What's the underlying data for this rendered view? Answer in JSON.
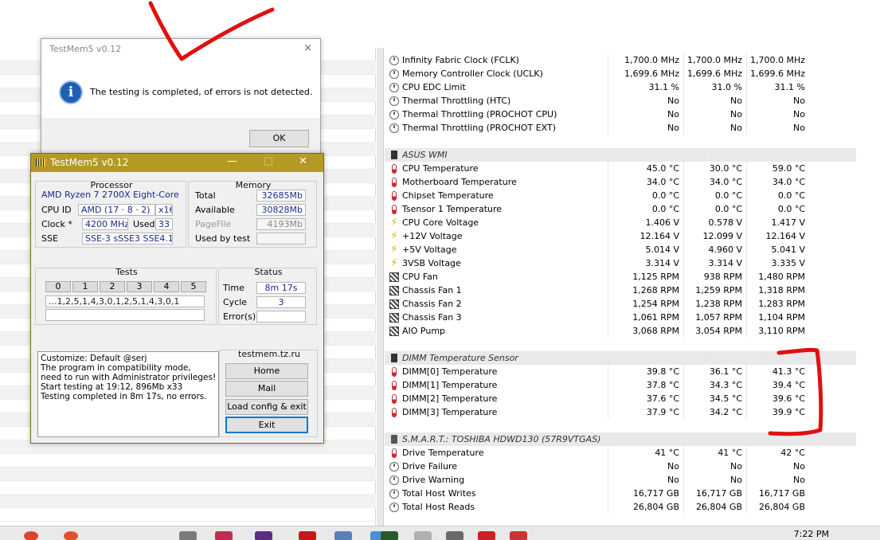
{
  "msgbox": {
    "title": "TestMem5 v0.12",
    "close": "×",
    "info_glyph": "i",
    "text": "The testing is completed, of errors is not detected.",
    "ok": "OK"
  },
  "tm": {
    "title": "TestMem5 v0.12",
    "minimize": "—",
    "maximize": "□",
    "close": "✕",
    "processor": {
      "heading": "Processor",
      "name": "AMD Ryzen 7 2700X Eight-Core",
      "cpuid_label": "CPU ID",
      "cpuid": "AMD  (17 · 8 · 2)",
      "arch": "x16",
      "clock_label": "Clock *",
      "clock": "4200 MHz",
      "used_label": "Used",
      "used": "33",
      "sse_label": "SSE",
      "sse": "SSE-3 sSSE3 SSE4.1"
    },
    "memory": {
      "heading": "Memory",
      "total_label": "Total",
      "total": "32685Mb",
      "available_label": "Available",
      "available": "30828Mb",
      "pagefile_label": "PageFile",
      "pagefile": "4193Mb",
      "usedbytest_label": "Used by test",
      "usedbytest": ""
    },
    "tests": {
      "heading": "Tests",
      "cells": [
        "0",
        "1",
        "2",
        "3",
        "4",
        "5"
      ],
      "sequence": "...1,2,5,1,4,3,0,1,2,5,1,4,3,0,1"
    },
    "status": {
      "heading": "Status",
      "time_label": "Time",
      "time": "8m 17s",
      "cycle_label": "Cycle",
      "cycle": "3",
      "errors_label": "Error(s)",
      "errors": ""
    },
    "log": "Customize: Default @serj\nThe program in compatibility mode,\nneed to run with Administrator privileges!\nStart testing at 19:12, 896Mb x33\nTesting completed in 8m 17s, no errors.",
    "site": "testmem.tz.ru",
    "buttons": {
      "home": "Home",
      "mail": "Mail",
      "load": "Load config & exit",
      "exit": "Exit"
    }
  },
  "sensors": [
    {
      "type": "row",
      "icon": "clock-icon",
      "name": "Infinity Fabric Clock (FCLK)",
      "cur": "1,700.0 MHz",
      "min": "1,700.0 MHz",
      "max": "1,700.0 MHz"
    },
    {
      "type": "row",
      "icon": "clock-icon",
      "name": "Memory Controller Clock (UCLK)",
      "cur": "1,699.6 MHz",
      "min": "1,699.6 MHz",
      "max": "1,699.6 MHz"
    },
    {
      "type": "row",
      "icon": "clock-icon",
      "name": "CPU EDC Limit",
      "cur": "31.1 %",
      "min": "31.0 %",
      "max": "31.1 %"
    },
    {
      "type": "row",
      "icon": "clock-icon",
      "name": "Thermal Throttling (HTC)",
      "cur": "No",
      "min": "No",
      "max": "No"
    },
    {
      "type": "row",
      "icon": "clock-icon",
      "name": "Thermal Throttling (PROCHOT CPU)",
      "cur": "No",
      "min": "No",
      "max": "No"
    },
    {
      "type": "row",
      "icon": "clock-icon",
      "name": "Thermal Throttling (PROCHOT EXT)",
      "cur": "No",
      "min": "No",
      "max": "No"
    },
    {
      "type": "blank"
    },
    {
      "type": "group",
      "icon": "chip-icon",
      "name": "ASUS WMI"
    },
    {
      "type": "row",
      "icon": "thermometer-icon",
      "name": "CPU Temperature",
      "cur": "45.0 °C",
      "min": "30.0 °C",
      "max": "59.0 °C"
    },
    {
      "type": "row",
      "icon": "thermometer-icon",
      "name": "Motherboard Temperature",
      "cur": "34.0 °C",
      "min": "34.0 °C",
      "max": "34.0 °C"
    },
    {
      "type": "row",
      "icon": "thermometer-icon",
      "name": "Chipset Temperature",
      "cur": "0.0 °C",
      "min": "0.0 °C",
      "max": "0.0 °C"
    },
    {
      "type": "row",
      "icon": "thermometer-icon",
      "name": "Tsensor 1 Temperature",
      "cur": "0.0 °C",
      "min": "0.0 °C",
      "max": "0.0 °C"
    },
    {
      "type": "row",
      "icon": "voltage-icon",
      "name": "CPU Core Voltage",
      "cur": "1.406 V",
      "min": "0.578 V",
      "max": "1.417 V"
    },
    {
      "type": "row",
      "icon": "voltage-icon",
      "name": "+12V Voltage",
      "cur": "12.164 V",
      "min": "12.099 V",
      "max": "12.164 V"
    },
    {
      "type": "row",
      "icon": "voltage-icon",
      "name": "+5V Voltage",
      "cur": "5.014 V",
      "min": "4.960 V",
      "max": "5.041 V"
    },
    {
      "type": "row",
      "icon": "voltage-icon",
      "name": "3VSB Voltage",
      "cur": "3.314 V",
      "min": "3.314 V",
      "max": "3.335 V"
    },
    {
      "type": "row",
      "icon": "fan-icon",
      "name": "CPU Fan",
      "cur": "1,125 RPM",
      "min": "938 RPM",
      "max": "1,480 RPM"
    },
    {
      "type": "row",
      "icon": "fan-icon",
      "name": "Chassis Fan 1",
      "cur": "1,268 RPM",
      "min": "1,259 RPM",
      "max": "1,318 RPM"
    },
    {
      "type": "row",
      "icon": "fan-icon",
      "name": "Chassis Fan 2",
      "cur": "1,254 RPM",
      "min": "1,238 RPM",
      "max": "1,283 RPM"
    },
    {
      "type": "row",
      "icon": "fan-icon",
      "name": "Chassis Fan 3",
      "cur": "1,061 RPM",
      "min": "1,057 RPM",
      "max": "1,104 RPM"
    },
    {
      "type": "row",
      "icon": "fan-icon",
      "name": "AIO Pump",
      "cur": "3,068 RPM",
      "min": "3,054 RPM",
      "max": "3,110 RPM"
    },
    {
      "type": "blank"
    },
    {
      "type": "group",
      "icon": "chip-icon",
      "name": "DIMM Temperature Sensor"
    },
    {
      "type": "row",
      "icon": "thermometer-icon",
      "name": "DIMM[0] Temperature",
      "cur": "39.8 °C",
      "min": "36.1 °C",
      "max": "41.3 °C"
    },
    {
      "type": "row",
      "icon": "thermometer-icon",
      "name": "DIMM[1] Temperature",
      "cur": "37.8 °C",
      "min": "34.3 °C",
      "max": "39.4 °C"
    },
    {
      "type": "row",
      "icon": "thermometer-icon",
      "name": "DIMM[2] Temperature",
      "cur": "37.6 °C",
      "min": "34.5 °C",
      "max": "39.6 °C"
    },
    {
      "type": "row",
      "icon": "thermometer-icon",
      "name": "DIMM[3] Temperature",
      "cur": "37.9 °C",
      "min": "34.2 °C",
      "max": "39.9 °C"
    },
    {
      "type": "blank"
    },
    {
      "type": "group",
      "icon": "disk-icon",
      "name": "S.M.A.R.T.: TOSHIBA HDWD130 (57R9VTGAS)"
    },
    {
      "type": "row",
      "icon": "thermometer-icon",
      "name": "Drive Temperature",
      "cur": "41 °C",
      "min": "41 °C",
      "max": "42 °C"
    },
    {
      "type": "row",
      "icon": "clock-icon",
      "name": "Drive Failure",
      "cur": "No",
      "min": "No",
      "max": "No"
    },
    {
      "type": "row",
      "icon": "clock-icon",
      "name": "Drive Warning",
      "cur": "No",
      "min": "No",
      "max": "No"
    },
    {
      "type": "row",
      "icon": "clock-icon",
      "name": "Total Host Writes",
      "cur": "16,717 GB",
      "min": "16,717 GB",
      "max": "16,717 GB"
    },
    {
      "type": "row",
      "icon": "clock-icon",
      "name": "Total Host Reads",
      "cur": "26,804 GB",
      "min": "26,804 GB",
      "max": "26,804 GB"
    }
  ],
  "taskbar": {
    "clock": "7:22 PM",
    "icons": [
      "chrome-icon",
      "chrome-icon",
      "app-icon",
      "app-icon",
      "app-icon",
      "acrobat-icon",
      "app-icon",
      "app-icon",
      "hwinfo-icon",
      "app-icon",
      "app-icon",
      "app-icon",
      "app-icon"
    ]
  },
  "colors": {
    "tm_title": "#b49a23",
    "value_blue": "#1a2a8a",
    "annotation_red": "#e01010",
    "info_blue": "#1f5fb3"
  }
}
